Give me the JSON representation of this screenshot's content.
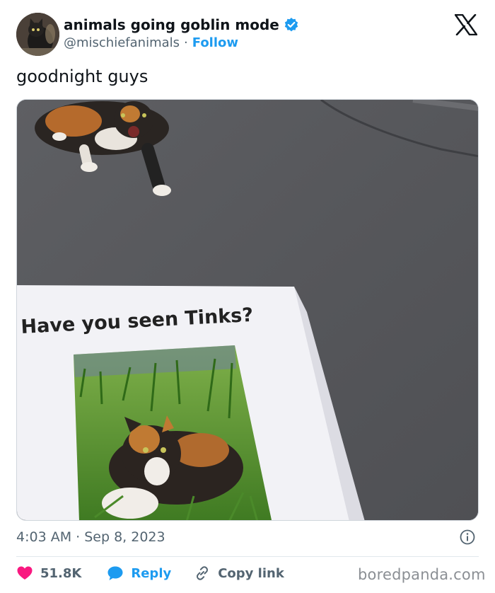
{
  "author": {
    "display_name": "animals going goblin mode",
    "handle": "@mischiefanimals",
    "separator": "·",
    "follow_label": "Follow"
  },
  "tweet": {
    "text": "goodnight guys",
    "timestamp": "4:03 AM · Sep 8, 2023"
  },
  "photo": {
    "poster_headline": "Have you seen Tinks?"
  },
  "actions": {
    "likes_count": "51.8K",
    "reply_label": "Reply",
    "copy_link_label": "Copy link"
  },
  "watermark": "boredpanda.com",
  "colors": {
    "accent": "#1d9bf0",
    "like": "#f91880",
    "muted_text": "#536471",
    "verified": "#1d9bf0"
  },
  "icons": {
    "verified": "verified-badge-icon",
    "brand": "x-logo-icon",
    "info": "info-icon",
    "like": "heart-icon",
    "reply": "chat-bubble-icon",
    "copy": "link-icon"
  }
}
